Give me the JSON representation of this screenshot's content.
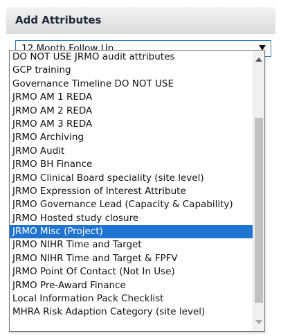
{
  "panel": {
    "title": "Add Attributes"
  },
  "select": {
    "value": "12 Month Follow Up",
    "open": true
  },
  "dropdown": {
    "options": [
      {
        "label": "DO NOT USE JRMO audit attributes",
        "selected": false
      },
      {
        "label": "GCP training",
        "selected": false
      },
      {
        "label": "Governance Timeline DO NOT USE",
        "selected": false
      },
      {
        "label": "JRMO AM 1 REDA",
        "selected": false
      },
      {
        "label": "JRMO AM 2 REDA",
        "selected": false
      },
      {
        "label": "JRMO AM 3 REDA",
        "selected": false
      },
      {
        "label": "JRMO Archiving",
        "selected": false
      },
      {
        "label": "JRMO Audit",
        "selected": false
      },
      {
        "label": "JRMO BH Finance",
        "selected": false
      },
      {
        "label": "JRMO Clinical Board speciality (site level)",
        "selected": false
      },
      {
        "label": "JRMO Expression of Interest Attribute",
        "selected": false
      },
      {
        "label": "JRMO Governance Lead (Capacity & Capability)",
        "selected": false
      },
      {
        "label": "JRMO Hosted study closure",
        "selected": false
      },
      {
        "label": "JRMO Misc (Project)",
        "selected": true
      },
      {
        "label": "JRMO NIHR Time and Target",
        "selected": false
      },
      {
        "label": "JRMO NIHR Time and Target & FPFV",
        "selected": false
      },
      {
        "label": "JRMO Point Of Contact (Not In Use)",
        "selected": false
      },
      {
        "label": "JRMO Pre-Award Finance",
        "selected": false
      },
      {
        "label": "Local Information Pack Checklist",
        "selected": false
      },
      {
        "label": "MHRA Risk Adaption Category (site level)",
        "selected": false
      }
    ],
    "scroll": {
      "thumb_start_fraction": 0.24,
      "thumb_end_fraction": 0.9
    }
  },
  "colors": {
    "selection": "#1f74d1",
    "select_border": "#2e77b8",
    "header_text": "#1e2a38"
  },
  "icons": {
    "select_arrow": "chevron-down-icon",
    "scroll_up": "scroll-up-arrow-icon",
    "scroll_down": "scroll-down-arrow-icon"
  }
}
